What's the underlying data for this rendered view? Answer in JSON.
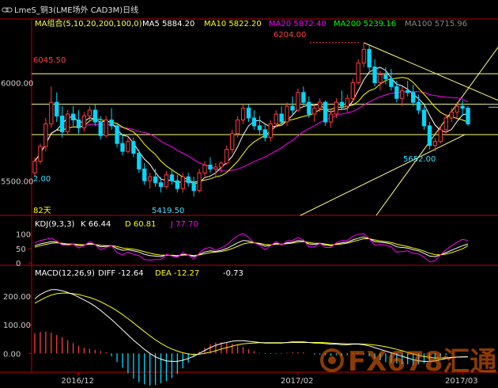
{
  "header": {
    "title": "LmeS_铜3(LME场外 CAD3M)日线",
    "icon_name": "chain-link-icon"
  },
  "ma_legend": [
    {
      "label": "MA组合(5,10,20,200,100,0)",
      "color": "#ffff55"
    },
    {
      "label": "MA5 5884.20",
      "color": "#ffffff"
    },
    {
      "label": "MA10 5822.20",
      "color": "#ffff00"
    },
    {
      "label": "MA20 5872.40",
      "color": "#ff00ff"
    },
    {
      "label": "MA200 5239.16",
      "color": "#00ff00"
    },
    {
      "label": "MA100 5715.96",
      "color": "#888888"
    }
  ],
  "kdj_legend": [
    {
      "label": "KDJ(9,3,3)",
      "color": "#ffffff"
    },
    {
      "label": "K 66.44",
      "color": "#ffffff"
    },
    {
      "label": "D 60.81",
      "color": "#ffff00"
    },
    {
      "label": "J 77.70",
      "color": "#ff00ff"
    }
  ],
  "macd_legend": [
    {
      "label": "MACD(12,26,9)",
      "color": "#ffffff"
    },
    {
      "label": "DIFF -12.64",
      "color": "#ffffff"
    },
    {
      "label": "DEA -12.27",
      "color": "#ffff00"
    },
    {
      "label": "-0.73",
      "color": "#ffffff"
    }
  ],
  "annotations": {
    "high": "6204.00",
    "low": "5419.50",
    "left_level": "6045.50",
    "swing_low": "5652.00",
    "left_edge_value": "2.00",
    "days_label": "82天"
  },
  "watermark": "FX678汇通网",
  "colors": {
    "up": "#ff3c3c",
    "down": "#00d8ff",
    "ma5": "#ffffff",
    "ma10": "#ffff00",
    "ma20": "#ff00ff",
    "level_line": "#ffff80",
    "axis": "#c00000",
    "axis_text": "#cccccc",
    "kdj_k": "#ffffff",
    "kdj_d": "#ffff00",
    "kdj_j": "#ff00ff",
    "macd_diff": "#ffffff",
    "macd_dea": "#ffff00"
  },
  "chart_data": [
    {
      "type": "candlestick",
      "title": "LmeS_铜3(LME场外 CAD3M)日线",
      "x_ticks": [
        "2016/12",
        "2017/02",
        "2017/03"
      ],
      "ylim": [
        5380,
        6260
      ],
      "y_ticks": [
        "6000.00",
        "5500.00"
      ],
      "y_tick_values": [
        6000,
        5500
      ],
      "levels": [
        6045.5,
        5890,
        5735
      ],
      "candles": [
        [
          5540,
          5620,
          5525,
          5600
        ],
        [
          5600,
          5690,
          5585,
          5675
        ],
        [
          5675,
          5820,
          5650,
          5790
        ],
        [
          5790,
          5980,
          5770,
          5900
        ],
        [
          5900,
          5950,
          5800,
          5830
        ],
        [
          5830,
          5880,
          5720,
          5750
        ],
        [
          5750,
          5860,
          5730,
          5840
        ],
        [
          5840,
          5880,
          5780,
          5810
        ],
        [
          5810,
          5860,
          5740,
          5770
        ],
        [
          5770,
          5850,
          5750,
          5830
        ],
        [
          5830,
          5880,
          5800,
          5860
        ],
        [
          5860,
          5890,
          5780,
          5800
        ],
        [
          5800,
          5830,
          5710,
          5730
        ],
        [
          5730,
          5830,
          5720,
          5810
        ],
        [
          5810,
          5870,
          5760,
          5780
        ],
        [
          5780,
          5790,
          5670,
          5690
        ],
        [
          5690,
          5740,
          5630,
          5650
        ],
        [
          5650,
          5720,
          5640,
          5700
        ],
        [
          5700,
          5720,
          5620,
          5640
        ],
        [
          5640,
          5660,
          5540,
          5560
        ],
        [
          5560,
          5590,
          5480,
          5500
        ],
        [
          5500,
          5540,
          5460,
          5520
        ],
        [
          5520,
          5560,
          5470,
          5490
        ],
        [
          5490,
          5520,
          5440,
          5470
        ],
        [
          5470,
          5550,
          5460,
          5530
        ],
        [
          5530,
          5560,
          5480,
          5500
        ],
        [
          5500,
          5530,
          5440,
          5460
        ],
        [
          5460,
          5540,
          5440,
          5520
        ],
        [
          5520,
          5540,
          5470,
          5490
        ],
        [
          5490,
          5520,
          5419.5,
          5450
        ],
        [
          5450,
          5560,
          5440,
          5540
        ],
        [
          5540,
          5600,
          5520,
          5580
        ],
        [
          5580,
          5620,
          5540,
          5560
        ],
        [
          5560,
          5590,
          5520,
          5570
        ],
        [
          5570,
          5600,
          5540,
          5590
        ],
        [
          5590,
          5680,
          5580,
          5660
        ],
        [
          5660,
          5760,
          5640,
          5740
        ],
        [
          5740,
          5830,
          5720,
          5810
        ],
        [
          5810,
          5890,
          5790,
          5870
        ],
        [
          5870,
          5890,
          5800,
          5820
        ],
        [
          5820,
          5860,
          5760,
          5780
        ],
        [
          5780,
          5830,
          5730,
          5760
        ],
        [
          5760,
          5790,
          5700,
          5720
        ],
        [
          5720,
          5810,
          5700,
          5790
        ],
        [
          5790,
          5860,
          5770,
          5840
        ],
        [
          5840,
          5880,
          5780,
          5800
        ],
        [
          5800,
          5900,
          5780,
          5880
        ],
        [
          5880,
          5930,
          5840,
          5860
        ],
        [
          5860,
          5970,
          5850,
          5950
        ],
        [
          5950,
          5980,
          5880,
          5900
        ],
        [
          5900,
          5930,
          5820,
          5840
        ],
        [
          5840,
          5890,
          5800,
          5870
        ],
        [
          5870,
          5920,
          5850,
          5900
        ],
        [
          5900,
          5910,
          5780,
          5800
        ],
        [
          5800,
          5860,
          5770,
          5840
        ],
        [
          5840,
          5920,
          5820,
          5900
        ],
        [
          5900,
          5960,
          5860,
          5880
        ],
        [
          5880,
          5940,
          5850,
          5920
        ],
        [
          5920,
          6020,
          5900,
          6000
        ],
        [
          6000,
          6120,
          5990,
          6100
        ],
        [
          6100,
          6204,
          6080,
          6170
        ],
        [
          6170,
          6190,
          6060,
          6080
        ],
        [
          6080,
          6120,
          5980,
          6000
        ],
        [
          6000,
          6060,
          5960,
          6040
        ],
        [
          6040,
          6080,
          5990,
          6020
        ],
        [
          6020,
          6070,
          5960,
          5980
        ],
        [
          5980,
          6010,
          5900,
          5920
        ],
        [
          5920,
          5980,
          5880,
          5960
        ],
        [
          5960,
          6010,
          5930,
          5950
        ],
        [
          5950,
          5990,
          5880,
          5900
        ],
        [
          5900,
          5940,
          5840,
          5860
        ],
        [
          5860,
          5880,
          5760,
          5780
        ],
        [
          5780,
          5800,
          5660,
          5680
        ],
        [
          5680,
          5720,
          5652,
          5700
        ],
        [
          5700,
          5780,
          5690,
          5760
        ],
        [
          5760,
          5840,
          5740,
          5820
        ],
        [
          5820,
          5870,
          5800,
          5850
        ],
        [
          5850,
          5900,
          5820,
          5880
        ],
        [
          5880,
          5910,
          5830,
          5870
        ],
        [
          5870,
          5880,
          5780,
          5790
        ]
      ]
    },
    {
      "type": "line",
      "title": "KDJ(9,3,3)",
      "y_ticks": [
        100,
        50,
        0
      ],
      "ylim": [
        -5,
        110
      ],
      "series": [
        {
          "name": "K",
          "values": [
            60,
            66,
            70,
            74,
            72,
            66,
            64,
            66,
            60,
            62,
            68,
            64,
            56,
            58,
            60,
            50,
            44,
            46,
            42,
            38,
            30,
            26,
            24,
            22,
            28,
            26,
            24,
            30,
            28,
            22,
            30,
            38,
            42,
            40,
            44,
            50,
            60,
            70,
            78,
            76,
            70,
            66,
            58,
            62,
            68,
            64,
            70,
            72,
            78,
            76,
            66,
            64,
            68,
            62,
            60,
            66,
            70,
            72,
            80,
            86,
            90,
            84,
            74,
            72,
            70,
            66,
            56,
            54,
            52,
            46,
            42,
            34,
            24,
            22,
            28,
            36,
            44,
            52,
            60,
            66
          ]
        },
        {
          "name": "D",
          "values": [
            55,
            60,
            64,
            68,
            70,
            68,
            66,
            66,
            64,
            63,
            65,
            64,
            61,
            60,
            60,
            57,
            52,
            50,
            48,
            44,
            39,
            34,
            30,
            27,
            27,
            27,
            26,
            27,
            28,
            26,
            28,
            32,
            36,
            38,
            40,
            44,
            50,
            58,
            66,
            70,
            70,
            68,
            64,
            63,
            65,
            65,
            67,
            69,
            73,
            74,
            71,
            68,
            68,
            66,
            63,
            64,
            66,
            69,
            74,
            79,
            84,
            84,
            80,
            76,
            74,
            71,
            65,
            61,
            57,
            52,
            47,
            41,
            34,
            29,
            28,
            31,
            36,
            42,
            49,
            60
          ]
        },
        {
          "name": "J",
          "values": [
            70,
            78,
            82,
            86,
            76,
            62,
            60,
            66,
            52,
            60,
            74,
            64,
            46,
            54,
            60,
            36,
            28,
            38,
            30,
            26,
            12,
            10,
            12,
            12,
            30,
            24,
            20,
            36,
            28,
            14,
            34,
            50,
            54,
            44,
            52,
            62,
            80,
            94,
            102,
            88,
            70,
            62,
            46,
            60,
            74,
            62,
            76,
            78,
            88,
            80,
            56,
            56,
            68,
            54,
            54,
            70,
            78,
            78,
            92,
            100,
            102,
            84,
            62,
            64,
            62,
            56,
            38,
            40,
            42,
            34,
            32,
            20,
            4,
            8,
            28,
            46,
            60,
            72,
            82,
            78
          ]
        }
      ]
    },
    {
      "type": "line",
      "title": "MACD(12,26,9)",
      "y_ticks": [
        "200.00",
        "100.00",
        "0.00"
      ],
      "y_tick_values": [
        200,
        100,
        0
      ],
      "ylim": [
        -60,
        260
      ],
      "series": [
        {
          "name": "DIFF",
          "values": [
            190,
            205,
            215,
            222,
            222,
            218,
            212,
            205,
            196,
            186,
            176,
            164,
            150,
            134,
            118,
            100,
            82,
            64,
            46,
            30,
            14,
            0,
            -12,
            -20,
            -26,
            -28,
            -28,
            -24,
            -18,
            -10,
            0,
            10,
            20,
            28,
            34,
            38,
            42,
            44,
            44,
            42,
            40,
            38,
            36,
            36,
            36,
            36,
            38,
            40,
            40,
            40,
            38,
            36,
            36,
            34,
            32,
            32,
            30,
            30,
            32,
            32,
            30,
            26,
            20,
            14,
            8,
            2,
            -4,
            -10,
            -16,
            -22,
            -26,
            -28,
            -28,
            -26,
            -22,
            -18,
            -15,
            -13,
            -12.64,
            -12
          ]
        },
        {
          "name": "DEA",
          "values": [
            175,
            185,
            195,
            203,
            208,
            210,
            210,
            208,
            205,
            200,
            195,
            188,
            180,
            170,
            160,
            148,
            135,
            121,
            106,
            91,
            76,
            61,
            47,
            35,
            24,
            15,
            8,
            2,
            -2,
            -4,
            -3,
            0,
            4,
            9,
            15,
            20,
            25,
            30,
            33,
            35,
            36,
            37,
            37,
            37,
            37,
            37,
            37,
            38,
            38,
            38,
            38,
            38,
            38,
            37,
            36,
            35,
            34,
            33,
            33,
            33,
            32,
            31,
            29,
            26,
            23,
            19,
            14,
            9,
            3,
            -2,
            -7,
            -11,
            -14,
            -16,
            -16,
            -15,
            -14,
            -13,
            -12.27,
            -12
          ]
        },
        {
          "name": "MACD",
          "values": [
            70,
            75,
            76,
            72,
            64,
            56,
            46,
            36,
            26,
            20,
            16,
            12,
            8,
            4,
            -10,
            -30,
            -50,
            -70,
            -88,
            -100,
            -108,
            -112,
            -110,
            -104,
            -96,
            -86,
            -72,
            -52,
            -32,
            -12,
            6,
            20,
            32,
            38,
            38,
            36,
            34,
            28,
            22,
            14,
            8,
            2,
            -2,
            -2,
            -2,
            -2,
            2,
            4,
            4,
            4,
            0,
            -4,
            -4,
            -6,
            -8,
            -6,
            -8,
            -6,
            -2,
            -2,
            -4,
            -10,
            -18,
            -24,
            -30,
            -34,
            -36,
            -38,
            -38,
            -40,
            -38,
            -34,
            -28,
            -20,
            -12,
            -6,
            -2,
            0,
            -0.73,
            0
          ]
        }
      ]
    }
  ]
}
